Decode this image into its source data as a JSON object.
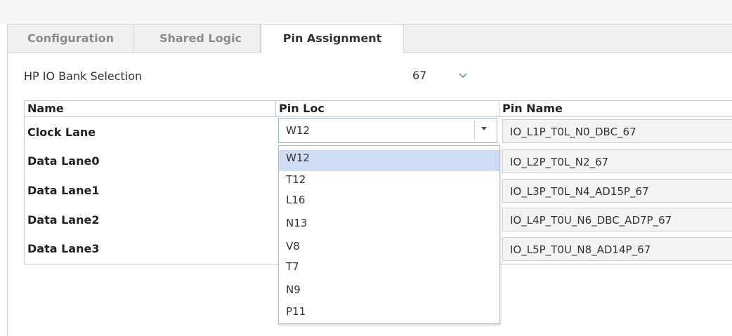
{
  "tabs": [
    {
      "label": "Configuration",
      "active": false
    },
    {
      "label": "Shared Logic",
      "active": false
    },
    {
      "label": "Pin Assignment",
      "active": true
    }
  ],
  "bank": {
    "label": "HP IO Bank Selection",
    "value": "67",
    "icon": "chevron-down-icon"
  },
  "table": {
    "headers": [
      "Name",
      "Pin Loc",
      "Pin Name"
    ],
    "rows": [
      {
        "name": "Clock Lane",
        "pin_loc": "W12",
        "pin_name": "IO_L1P_T0L_N0_DBC_67"
      },
      {
        "name": "Data Lane0",
        "pin_loc": "",
        "pin_name": "IO_L2P_T0L_N2_67"
      },
      {
        "name": "Data Lane1",
        "pin_loc": "",
        "pin_name": "IO_L3P_T0L_N4_AD15P_67"
      },
      {
        "name": "Data Lane2",
        "pin_loc": "",
        "pin_name": "IO_L4P_T0U_N6_DBC_AD7P_67"
      },
      {
        "name": "Data Lane3",
        "pin_loc": "",
        "pin_name": "IO_L5P_T0U_N8_AD14P_67"
      }
    ]
  },
  "dropdown": {
    "selected": "W12",
    "options": [
      "W12",
      "T12",
      "L16",
      "N13",
      "V8",
      "T7",
      "N9",
      "P11"
    ],
    "highlight_color": "#cfdcf5"
  }
}
